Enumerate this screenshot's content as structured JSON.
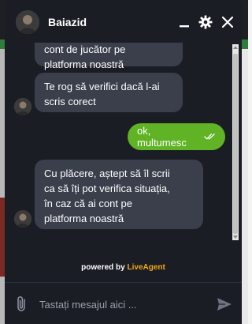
{
  "header": {
    "agent_name": "Baiazid",
    "avatar_icon": "agent-avatar",
    "minimize_icon": "minimize-icon",
    "settings_icon": "gear-icon",
    "close_icon": "close-icon"
  },
  "messages": [
    {
      "direction": "incoming",
      "lines": [
        "cont de jucător pe",
        "platforma noastră"
      ]
    },
    {
      "direction": "incoming",
      "lines": [
        "Te rog să verifici dacă l-ai",
        "scris corect"
      ]
    },
    {
      "direction": "outgoing",
      "lines": [
        "ok, multumesc"
      ],
      "status_icon": "double-check-icon"
    },
    {
      "direction": "incoming",
      "lines": [
        "Cu plăcere, aștept să îl scrii",
        "ca să îți pot verifica situația,",
        "în caz că ai cont pe",
        "platforma noastră"
      ]
    }
  ],
  "footer": {
    "powered_by": "powered by",
    "brand": "LiveAgent"
  },
  "composer": {
    "placeholder": "Tastați mesajul aici ...",
    "value": ""
  },
  "colors": {
    "widget_bg": "#1a1d24",
    "incoming_bubble": "#3a3f4b",
    "outgoing_bubble": "#5fb324",
    "brand": "#f2a51a"
  }
}
